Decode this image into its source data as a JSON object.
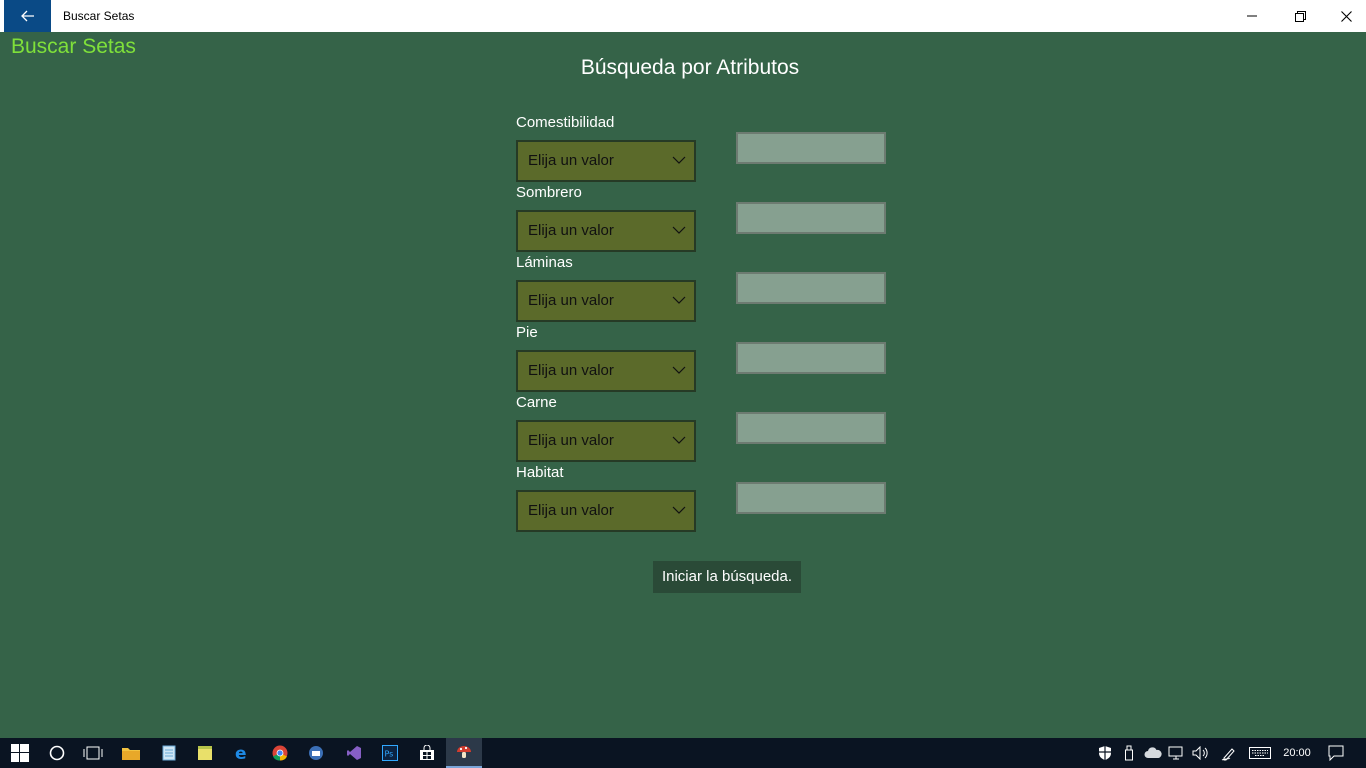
{
  "window": {
    "title": "Buscar Setas",
    "back_icon": "arrow-left-icon",
    "controls": [
      "minimize-icon",
      "restore-icon",
      "close-icon"
    ]
  },
  "app": {
    "title": "Buscar Setas",
    "page_title": "Búsqueda por Atributos",
    "fields": [
      {
        "label": "Comestibilidad",
        "value": "Elija un valor",
        "text": ""
      },
      {
        "label": "Sombrero",
        "value": "Elija un valor",
        "text": ""
      },
      {
        "label": "Láminas",
        "value": "Elija un valor",
        "text": ""
      },
      {
        "label": "Pie",
        "value": "Elija un valor",
        "text": ""
      },
      {
        "label": "Carne",
        "value": "Elija un valor",
        "text": ""
      },
      {
        "label": "Habitat",
        "value": "Elija un valor",
        "text": ""
      }
    ],
    "search_button": "Iniciar la búsqueda."
  },
  "colors": {
    "background": "#356348",
    "app_title": "#7fe03a",
    "combo_bg": "#5b6a2a",
    "textbox_bg": "#86a090",
    "button_bg": "#2a4a37",
    "taskbar": "#0a1422"
  },
  "taskbar": {
    "apps": [
      "windows-start-icon",
      "cortana-icon",
      "task-view-icon",
      "file-explorer-icon",
      "notepad-icon",
      "sticky-notes-icon",
      "edge-icon",
      "chrome-icon",
      "thunderbird-icon",
      "visual-studio-icon",
      "photoshop-icon",
      "store-icon",
      "mushroom-app-icon"
    ],
    "tray": [
      "defender-icon",
      "usb-icon",
      "onedrive-icon",
      "network-icon",
      "volume-icon",
      "pen-icon",
      "keyboard-icon"
    ],
    "clock": "20:00"
  }
}
